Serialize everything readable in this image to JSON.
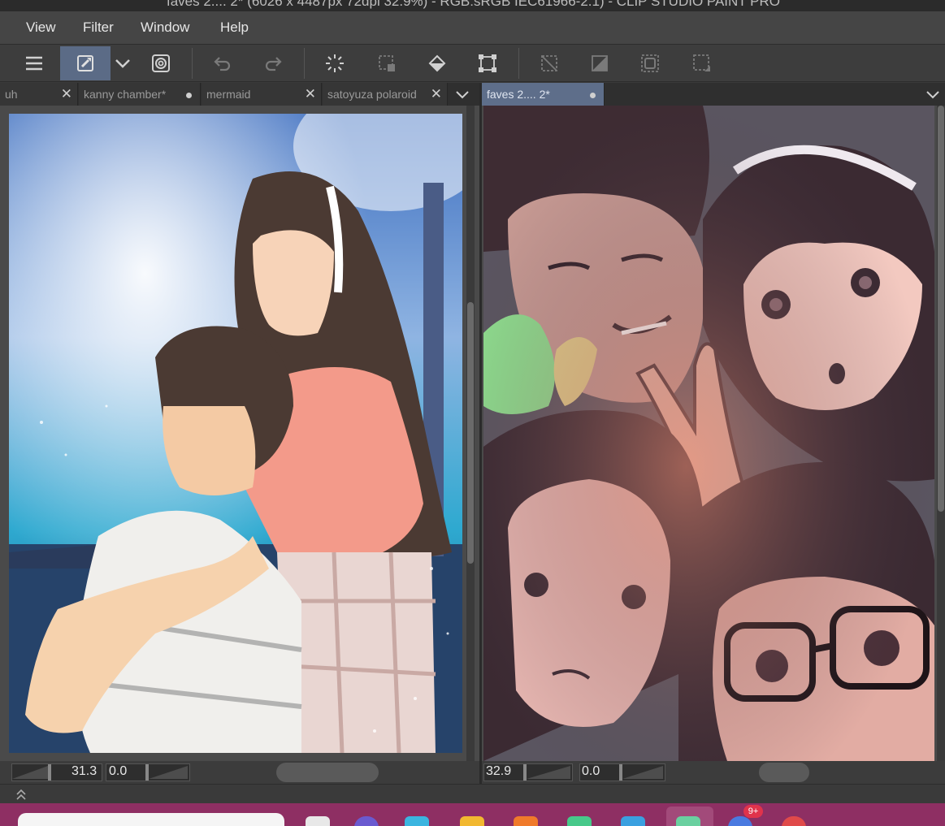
{
  "window": {
    "title": "faves 2.... 2* (6026 x 4487px 72dpi 32.9%) - RGB:sRGB IEC61966-2.1) - CLIP STUDIO PAINT PRO"
  },
  "menu": [
    "View",
    "Filter",
    "Window",
    "Help"
  ],
  "toolbar": {
    "icons": [
      "menu-icon",
      "eraser-icon",
      "chevron-down-icon",
      "lasso-icon",
      "undo-icon",
      "redo-icon",
      "loading-icon",
      "select-icon",
      "fill-icon",
      "transform-icon",
      "clear-selection-icon",
      "invert-selection-icon",
      "select-layer-icon",
      "crop-icon"
    ]
  },
  "left_tabs": [
    {
      "label": "uh",
      "state": "close"
    },
    {
      "label": "kanny chamber*",
      "state": "dot"
    },
    {
      "label": "mermaid",
      "state": "close"
    },
    {
      "label": "satoyuza polaroid",
      "state": "close"
    }
  ],
  "right_tabs": [
    {
      "label": "faves 2.... 2*",
      "state": "dot"
    }
  ],
  "left_status": {
    "zoom": "31.3",
    "rotation": "0.0"
  },
  "right_status": {
    "zoom": "32.9",
    "rotation": "0.0"
  },
  "taskbar": {
    "badge": "9+"
  },
  "colors": {
    "accent": "#5e6e8a",
    "taskbar": "#8e2f63"
  }
}
